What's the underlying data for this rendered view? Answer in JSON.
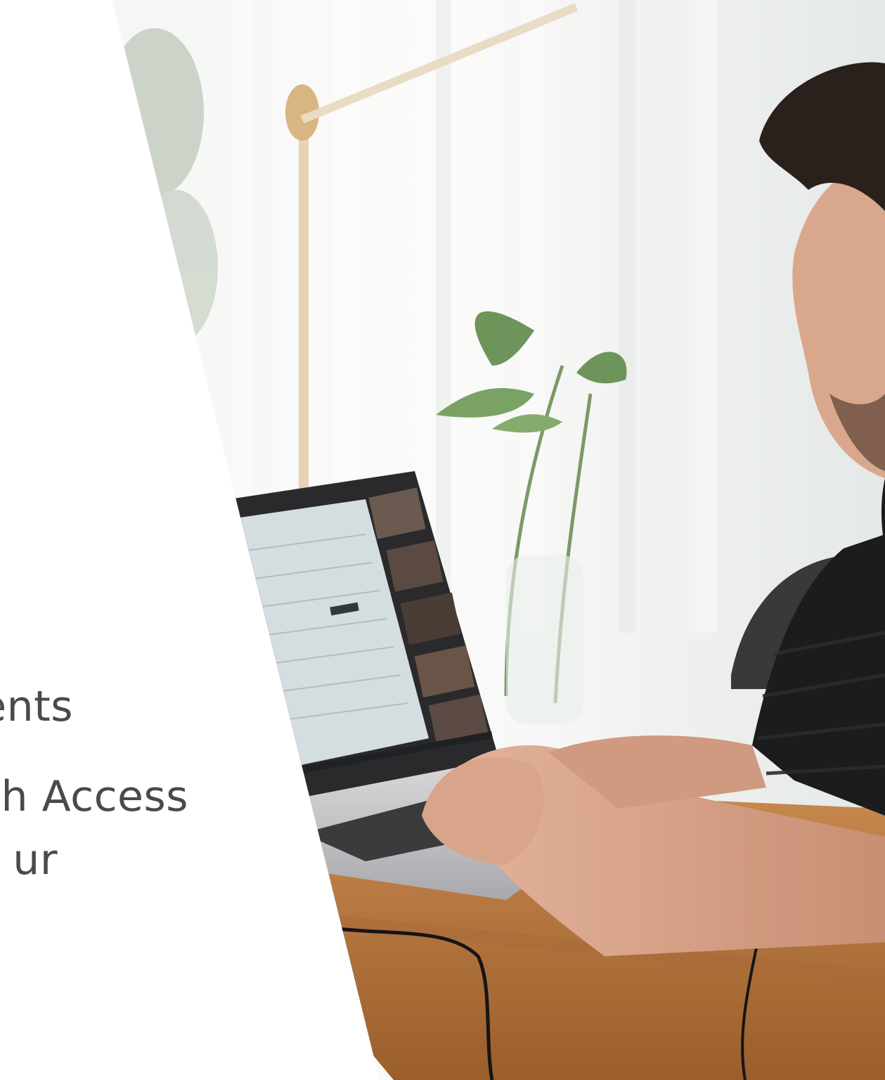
{
  "copy": {
    "line_1": "ents",
    "line_2": "th Access",
    "line_3": "ur"
  },
  "photo": {
    "icon": "person-using-laptop-photo"
  },
  "colors": {
    "background": "#ffffff",
    "text": "#4a4a4a",
    "table_wood": "#b9773f",
    "shirt": "#1c1c1c",
    "skin": "#d8a48a",
    "laptop_body": "#c9c9cb",
    "screen_frame": "#2a2a2c",
    "plant_leaf": "#5f8a4a"
  }
}
